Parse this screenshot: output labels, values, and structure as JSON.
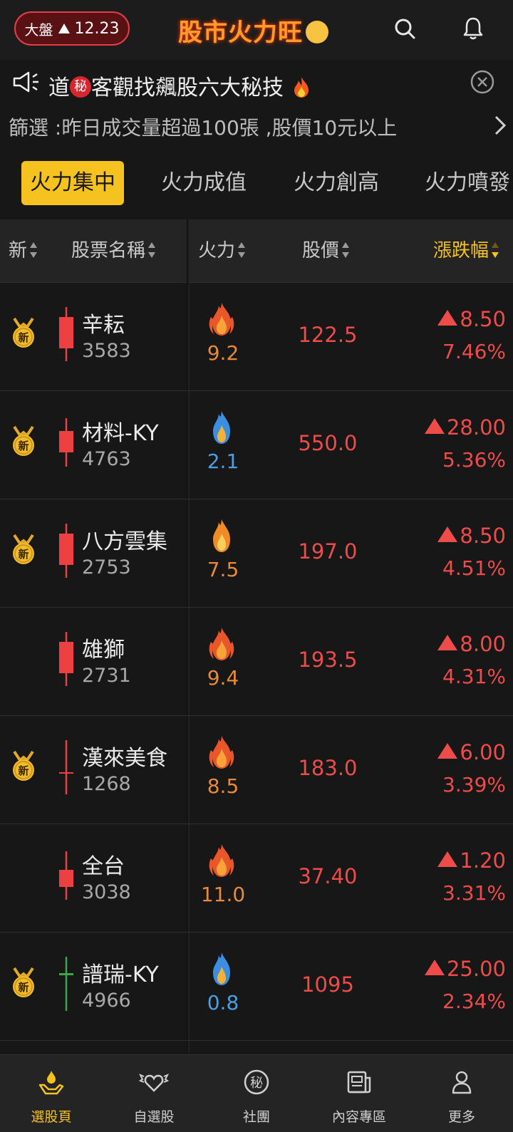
{
  "header": {
    "market_label": "大盤",
    "market_change": "12.23",
    "app_title": "股市火力旺"
  },
  "announcement": {
    "text_before": "道",
    "secret_badge": "秘",
    "text_after": "客觀找飆股六大秘技"
  },
  "filter": {
    "text": "篩選 :昨日成交量超過100張 ,股價10元以上"
  },
  "tabs": [
    {
      "label": "火力集中",
      "active": true
    },
    {
      "label": "火力成值",
      "active": false
    },
    {
      "label": "火力創高",
      "active": false
    },
    {
      "label": "火力噴發",
      "active": false
    }
  ],
  "table": {
    "headers": {
      "new": "新",
      "name": "股票名稱",
      "fire": "火力",
      "price": "股價",
      "change": "漲跌幅"
    },
    "sorted_column": "change",
    "new_badge": "新",
    "rows": [
      {
        "name": "辛耘",
        "code": "3583",
        "fire": "9.2",
        "price": "122.5",
        "change": "8.50",
        "pct": "7.46%",
        "is_new": true,
        "flame": "red",
        "candle": "red-tall"
      },
      {
        "name": "材料-KY",
        "code": "4763",
        "fire": "2.1",
        "price": "550.0",
        "change": "28.00",
        "pct": "5.36%",
        "is_new": true,
        "flame": "blue",
        "candle": "red-mid"
      },
      {
        "name": "八方雲集",
        "code": "2753",
        "fire": "7.5",
        "price": "197.0",
        "change": "8.50",
        "pct": "4.51%",
        "is_new": true,
        "flame": "orange",
        "candle": "red-tall"
      },
      {
        "name": "雄獅",
        "code": "2731",
        "fire": "9.4",
        "price": "193.5",
        "change": "8.00",
        "pct": "4.31%",
        "is_new": false,
        "flame": "red",
        "candle": "red-tall"
      },
      {
        "name": "漢來美食",
        "code": "1268",
        "fire": "8.5",
        "price": "183.0",
        "change": "6.00",
        "pct": "3.39%",
        "is_new": true,
        "flame": "red",
        "candle": "red-doji"
      },
      {
        "name": "全台",
        "code": "3038",
        "fire": "11.0",
        "price": "37.40",
        "change": "1.20",
        "pct": "3.31%",
        "is_new": false,
        "flame": "red",
        "candle": "red-small"
      },
      {
        "name": "譜瑞-KY",
        "code": "4966",
        "fire": "0.8",
        "price": "1095",
        "change": "25.00",
        "pct": "2.34%",
        "is_new": true,
        "flame": "blue",
        "candle": "green-doji"
      }
    ]
  },
  "bottom_nav": [
    {
      "label": "選股頁",
      "icon": "fire-hand-icon",
      "active": true
    },
    {
      "label": "自選股",
      "icon": "heart-wings-icon",
      "active": false
    },
    {
      "label": "社團",
      "icon": "secret-circle-icon",
      "active": false
    },
    {
      "label": "內容專區",
      "icon": "newspaper-icon",
      "active": false
    },
    {
      "label": "更多",
      "icon": "person-icon",
      "active": false
    }
  ],
  "colors": {
    "accent": "#f5c220",
    "up": "#ee4b4b",
    "down": "#3fa54a",
    "background": "#171717",
    "fire_orange": "#e88a3a",
    "fire_blue": "#4a9fe6"
  }
}
